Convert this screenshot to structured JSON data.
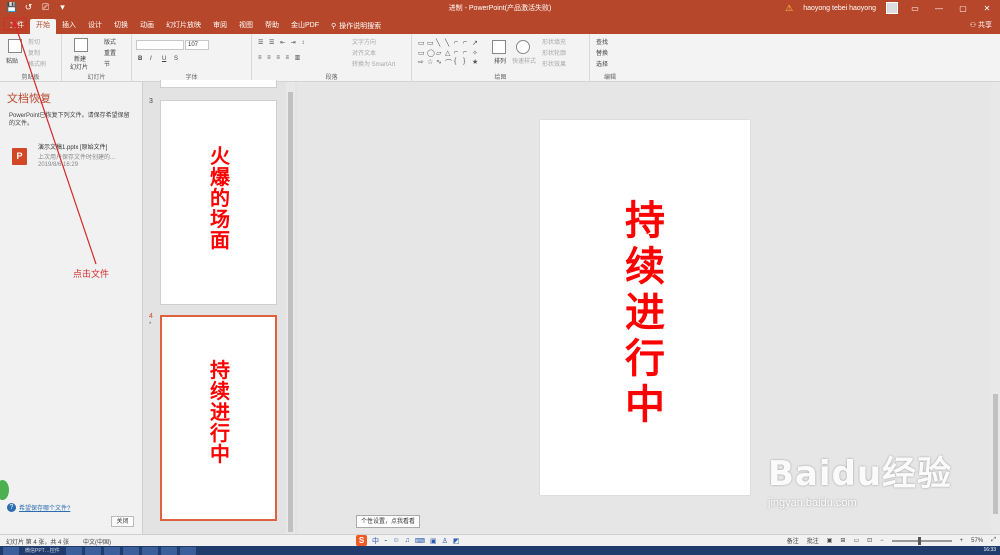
{
  "window": {
    "title": "进制 - PowerPoint(产品激活失败)",
    "user": "haoyong tebei haoyong",
    "controls": [
      "▭",
      "—",
      "▢",
      "✕"
    ]
  },
  "qat": [
    "💾",
    "↺",
    "⎚",
    "▾"
  ],
  "tabs": [
    "文件",
    "开始",
    "插入",
    "设计",
    "切换",
    "动画",
    "幻灯片放映",
    "审阅",
    "视图",
    "帮助",
    "金山PDF"
  ],
  "tell_me": "操作说明搜索",
  "share": "共享",
  "ribbon": {
    "clipboard": {
      "paste": "粘贴",
      "cut": "剪切",
      "copy": "复制",
      "format_painter": "格式刷",
      "label": "剪贴板"
    },
    "slides": {
      "new": "新建",
      "new2": "幻灯片",
      "layout": "版式",
      "reset": "重置",
      "section": "节",
      "label": "幻灯片"
    },
    "font": {
      "size": "107",
      "label": "字体",
      "b": "B",
      "i": "I",
      "u": "U",
      "s": "S"
    },
    "paragraph": {
      "text_dir": "文字方向",
      "align_text": "对齐文本",
      "smartart": "转换为 SmartArt",
      "label": "段落"
    },
    "drawing": {
      "arrange": "排列",
      "quick_styles": "快速样式",
      "fill": "形状填充",
      "outline": "形状轮廓",
      "effects": "形状效果",
      "label": "绘图"
    },
    "editing": {
      "find": "查找",
      "replace": "替换",
      "select": "选择",
      "label": "编辑"
    }
  },
  "recovery": {
    "title": "文档恢复",
    "message": "PowerPoint已恢复下列文件。请保存希望保留的文件。",
    "file_name": "演示文稿1.pptx [原始文件]",
    "file_desc": "上次用户保存文件时创建的...",
    "file_time": "2019/8/6 16:29",
    "help_link": "希望保存哪个文件?",
    "close": "关闭"
  },
  "thumbnails": [
    {
      "number": "3",
      "text": "火爆的场面"
    },
    {
      "number": "4",
      "star": "*",
      "text": "持续进行中"
    }
  ],
  "slide": {
    "text": "持续进行中"
  },
  "annotation": "点击文件",
  "tooltip": "个性设置，点我看看",
  "status": {
    "slide_info": "幻灯片 第 4 张，共 4 张",
    "language": "中文(中国)",
    "notes": "备注",
    "comments": "批注",
    "zoom": "57%"
  },
  "ime": {
    "mode": "中"
  },
  "taskbar": {
    "item": "微信PPT…控件",
    "time": "16:33"
  },
  "watermark": {
    "logo": "Baidu经验",
    "url": "jingyan.baidu.com"
  },
  "colors": {
    "accent": "#b7472a",
    "slide_text": "#ff0000"
  }
}
